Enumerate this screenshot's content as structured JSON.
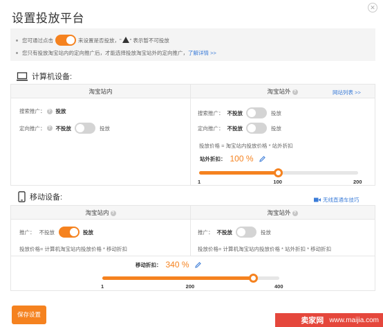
{
  "title": "设置投放平台",
  "notice": {
    "line1_pre": "您可通过点击",
    "line1_mid": "来设置是否投放，\"",
    "line1_post": "\" 表示暂不可投放",
    "line2": "您只有投放淘宝站内的定向推广后，才能选择投放淘宝站外的定向推广，",
    "line2_link": "了解详情 >>",
    "toggle_state": "on"
  },
  "computer": {
    "heading": "计算机设备:",
    "col_inside": "淘宝站内",
    "col_outside": "淘宝站外",
    "site_list_link": "网站列表 >>",
    "inside": {
      "search": {
        "label": "搜索推广：",
        "value": "投放"
      },
      "targeting": {
        "label": "定向推广：",
        "off_label": "不投放",
        "on_label": "投放",
        "toggle_state": "off"
      }
    },
    "outside": {
      "search": {
        "label": "搜索推广：",
        "off_label": "不投放",
        "on_label": "投放",
        "toggle_state": "off"
      },
      "targeting": {
        "label": "定向推广：",
        "off_label": "不投放",
        "on_label": "投放",
        "toggle_state": "off"
      },
      "formula": "投放价格 = 淘宝站内投放价格 * 站外折扣",
      "discount_label": "站外折扣：",
      "discount_value": "100 %",
      "slider": {
        "min": 1,
        "max": 200,
        "value": 100,
        "ticks": [
          "1",
          "100",
          "200"
        ]
      }
    }
  },
  "mobile": {
    "heading": "移动设备:",
    "tips_link": "无线直通车技巧",
    "col_inside": "淘宝站内",
    "col_outside": "淘宝站外",
    "inside": {
      "label": "推广：",
      "off_label": "不投放",
      "on_label": "投放",
      "toggle_state": "on",
      "formula": "投放价格= 计算机淘宝站内投放价格 * 移动折扣"
    },
    "outside": {
      "label": "推广：",
      "off_label": "不投放",
      "on_label": "投放",
      "toggle_state": "off",
      "formula": "投放价格= 计算机淘宝站内投放价格 * 站外折扣 * 移动折扣"
    },
    "discount_label": "移动折扣：",
    "discount_value": "340 %",
    "slider": {
      "min": 1,
      "max": 400,
      "value": 340,
      "ticks": [
        "1",
        "200",
        "400"
      ]
    }
  },
  "save_button": "保存设置",
  "watermark": {
    "site": "卖家网",
    "url": "www.maijia.com"
  },
  "colors": {
    "accent": "#f5821f",
    "link": "#3b7cd8",
    "watermark": "#e5473c"
  }
}
